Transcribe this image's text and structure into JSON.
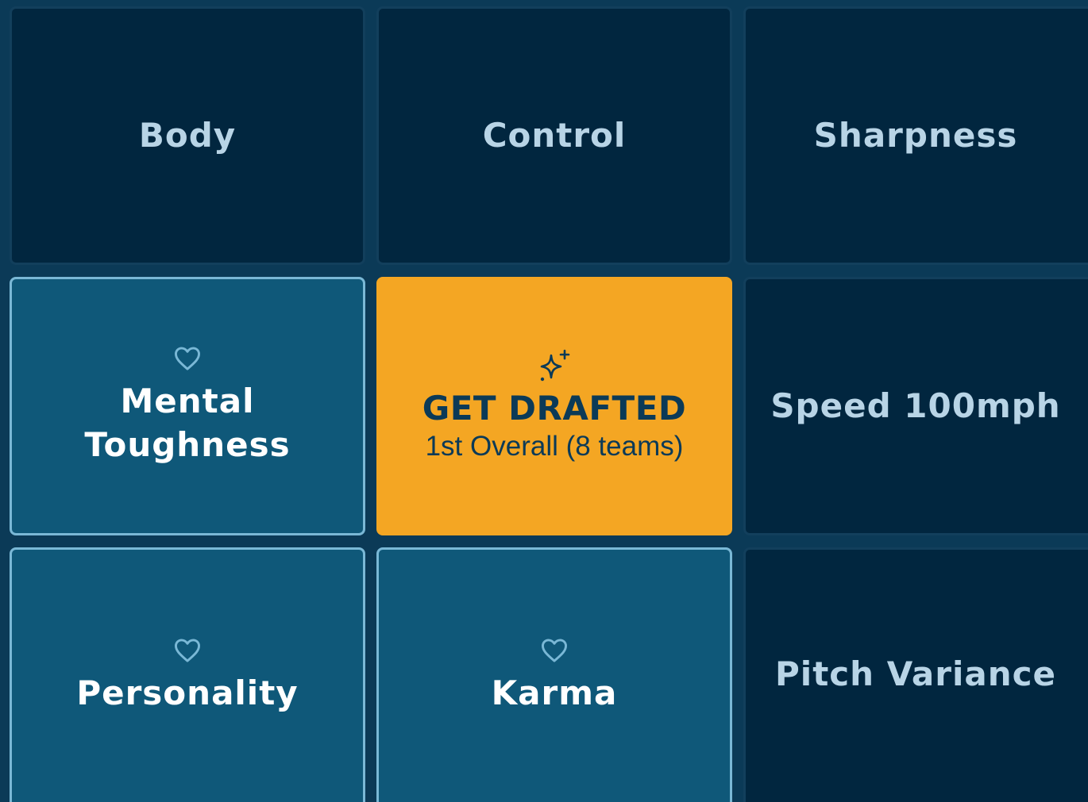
{
  "cells": [
    {
      "label": "Body",
      "state": "locked"
    },
    {
      "label": "Control",
      "state": "locked"
    },
    {
      "label": "Sharpness",
      "state": "locked"
    },
    {
      "label_line1": "Mental",
      "label_line2": "Toughness",
      "state": "favorited",
      "icon": "heart-icon"
    },
    {
      "label": "GET DRAFTED",
      "sub": "1st Overall (8 teams)",
      "state": "center",
      "icon": "sparkle-icon"
    },
    {
      "label": "Speed 100mph",
      "state": "locked"
    },
    {
      "label": "Personality",
      "state": "favorited",
      "icon": "heart-icon"
    },
    {
      "label": "Karma",
      "state": "favorited",
      "icon": "heart-icon"
    },
    {
      "label": "Pitch Variance",
      "state": "locked"
    }
  ],
  "colors": {
    "background": "#0b3a57",
    "dark_cell": "#01263f",
    "blue_cell": "#0f5879",
    "center_cell": "#f4a623",
    "dark_text": "#b8d4e6",
    "blue_text": "#ffffff",
    "center_text": "#0b3a57"
  }
}
